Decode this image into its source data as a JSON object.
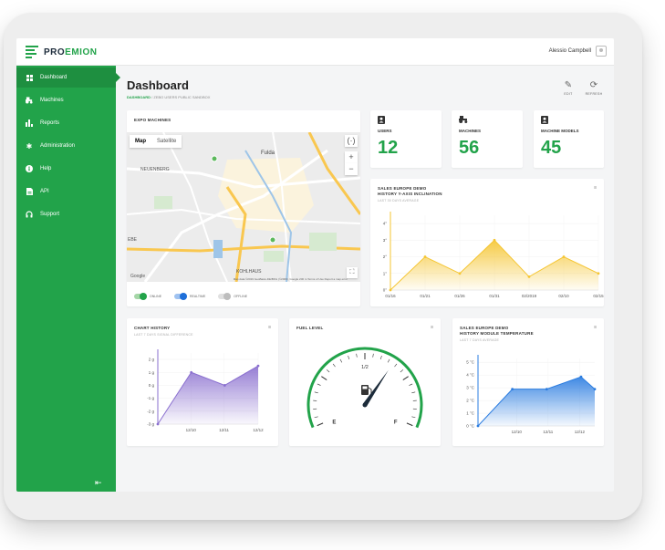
{
  "header": {
    "logo_text": "PROEMION",
    "logo_prefix": "PRO",
    "logo_suffix": "EMION",
    "user_name": "Alessio Campbell"
  },
  "sidebar": {
    "items": [
      {
        "label": "Dashboard",
        "icon": "grid-icon"
      },
      {
        "label": "Machines",
        "icon": "tractor-icon"
      },
      {
        "label": "Reports",
        "icon": "bar-chart-icon"
      },
      {
        "label": "Administration",
        "icon": "gear-icon"
      },
      {
        "label": "Help",
        "icon": "info-icon"
      },
      {
        "label": "API",
        "icon": "document-icon"
      },
      {
        "label": "Support",
        "icon": "headset-icon"
      }
    ],
    "collapse_icon": "collapse-left-icon"
  },
  "page": {
    "title": "Dashboard",
    "breadcrumb_1": "DASHBOARD",
    "breadcrumb_sep": "/",
    "breadcrumb_2": "ZEBO USERS PUBLIC SANDBOX",
    "edit_label": "EDIT",
    "refresh_label": "REFRESH"
  },
  "map_card": {
    "title": "EXPO MACHINES",
    "tab_map": "Map",
    "tab_satellite": "Satellite",
    "fullscreen_label": "(·)",
    "zoom_in": "+",
    "zoom_out": "−",
    "place_fulda": "Fulda",
    "place_neuenberg": "NEUENBERG",
    "place_kohlhaus": "KOHLHAUS",
    "place_edge": "EBE",
    "credit": "Map data ©2019 GeoBasis-DE/BKG (©2009), Google   200 m  Terms of Use   Report a map error",
    "google_mark": "Google",
    "legend": [
      {
        "label": "ONLINE",
        "color": "#22a34a"
      },
      {
        "label": "REALTIME",
        "color": "#1e6fd9"
      },
      {
        "label": "OFFLINE",
        "color": "#bdbdbd"
      }
    ]
  },
  "stats": [
    {
      "label": "USERS",
      "value": "12",
      "icon": "user-badge-icon"
    },
    {
      "label": "MACHINES",
      "value": "56",
      "icon": "tractor-icon"
    },
    {
      "label": "MACHINE MODELS",
      "value": "45",
      "icon": "user-badge-icon"
    }
  ],
  "colors": {
    "brand": "#22a34a",
    "yellow": "#f5c531",
    "purple": "#8a6fcf",
    "blue": "#2a7ce0"
  },
  "card_menu_label": "Ⅲ",
  "charts": {
    "sales_inclination": {
      "title_line1": "SALES EUROPE DEMO",
      "title_line2": "HISTORY Y-AXIS INCLINATION",
      "subtitle": "LAST 30 DAYS AVERAGE"
    },
    "chart_history": {
      "title": "CHART HISTORY",
      "subtitle": "LAST 7 DAYS SIGNAL DIFFERENCE"
    },
    "fuel_level": {
      "title": "FUEL LEVEL",
      "label_empty": "E",
      "label_half": "1/2",
      "label_full": "F"
    },
    "sales_temperature": {
      "title_line1": "SALES EUROPE DEMO",
      "title_line2": "HISTORY MODULE TEMPERATURE",
      "subtitle": "LAST 7 DAYS AVERAGE"
    }
  },
  "chart_data": [
    {
      "type": "area",
      "x": [
        "01/16",
        "01/21",
        "01/26",
        "01/31",
        "02/2019",
        "02/10",
        "02/15"
      ],
      "y_ticks": [
        "0°",
        "1°",
        "2°",
        "3°",
        "4°"
      ],
      "values": [
        0,
        2,
        1,
        3,
        0.8,
        2,
        1
      ],
      "ylim": [
        0,
        4
      ],
      "color": "#f5c531"
    },
    {
      "type": "area",
      "x": [
        "12/10",
        "12/11",
        "12/12"
      ],
      "y_ticks": [
        "-3 g",
        "-2 g",
        "-1 g",
        "0 g",
        "1 g",
        "2 g"
      ],
      "series_x": [
        0,
        1,
        2,
        3
      ],
      "values": [
        -3,
        1,
        0,
        1.5
      ],
      "ylim": [
        -3,
        2.5
      ],
      "color": "#8a6fcf"
    },
    {
      "type": "gauge",
      "value": 0.65,
      "color": "#22a34a"
    },
    {
      "type": "area",
      "x": [
        "12/10",
        "12/11",
        "12/12"
      ],
      "y_ticks": [
        "0 °C",
        "1 °C",
        "2 °C",
        "3 °C",
        "4 °C",
        "5 °C"
      ],
      "series_x": [
        0,
        1,
        2,
        3,
        3.4
      ],
      "values": [
        0,
        3,
        3,
        4,
        3
      ],
      "ylim": [
        0,
        5.5
      ],
      "color": "#2a7ce0"
    }
  ]
}
